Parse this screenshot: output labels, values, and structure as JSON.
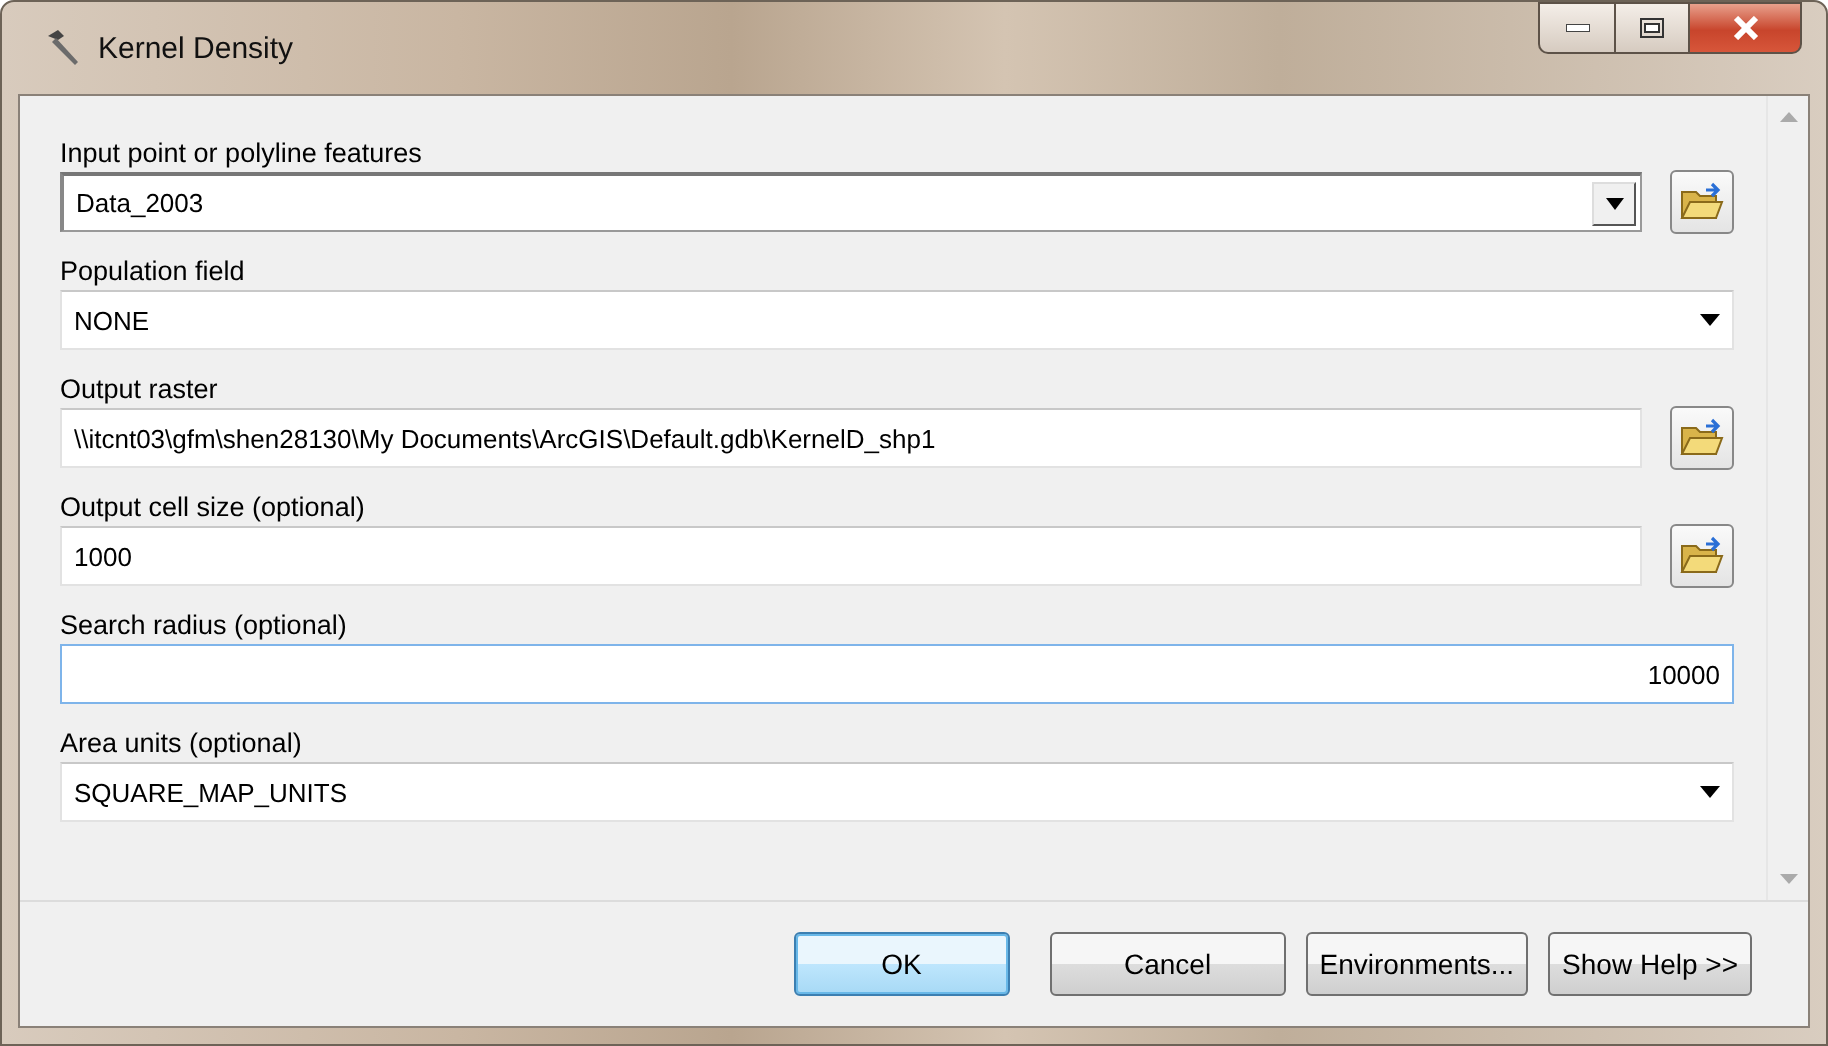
{
  "window": {
    "title": "Kernel Density"
  },
  "parameters": [
    {
      "label": "Input point or polyline features",
      "value": "Data_2003",
      "kind": "combo",
      "browse": true,
      "focused": false
    },
    {
      "label": "Population field",
      "value": "NONE",
      "kind": "dropdown",
      "browse": false,
      "focused": false
    },
    {
      "label": "Output raster",
      "value": "\\\\itcnt03\\gfm\\shen28130\\My Documents\\ArcGIS\\Default.gdb\\KernelD_shp1",
      "kind": "text",
      "browse": true,
      "focused": false
    },
    {
      "label": "Output cell size (optional)",
      "value": "1000",
      "kind": "text",
      "browse": true,
      "focused": false
    },
    {
      "label": "Search radius (optional)",
      "value": "10000",
      "kind": "number",
      "browse": false,
      "focused": true
    },
    {
      "label": "Area units (optional)",
      "value": "SQUARE_MAP_UNITS",
      "kind": "dropdown",
      "browse": false,
      "focused": false
    }
  ],
  "buttons": [
    {
      "label": "OK",
      "default": true
    },
    {
      "label": "Cancel",
      "default": false
    },
    {
      "label": "Environments...",
      "default": false
    },
    {
      "label": "Show Help >>",
      "default": false
    }
  ]
}
